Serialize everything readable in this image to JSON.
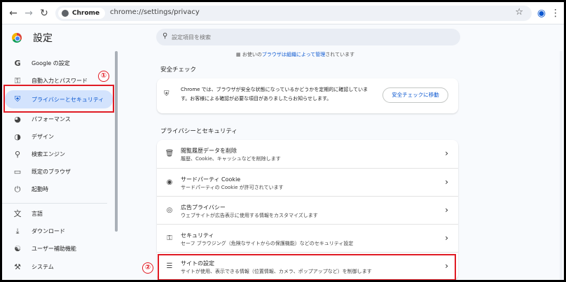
{
  "toolbar": {
    "chip_label": "Chrome",
    "url": "chrome://settings/privacy",
    "back_icon": "back-arrow-icon",
    "forward_icon": "forward-arrow-icon",
    "reload_icon": "reload-icon"
  },
  "header": {
    "title": "設定",
    "search_placeholder": "設定項目を検索"
  },
  "sidebar": {
    "items": [
      {
        "label": "Google の設定",
        "icon": "google-icon"
      },
      {
        "label": "自動入力とパスワード",
        "icon": "key-icon"
      },
      {
        "label": "プライバシーとセキュリティ",
        "icon": "shield-icon"
      },
      {
        "label": "パフォーマンス",
        "icon": "speedometer-icon"
      },
      {
        "label": "デザイン",
        "icon": "palette-icon"
      },
      {
        "label": "検索エンジン",
        "icon": "search-icon"
      },
      {
        "label": "既定のブラウザ",
        "icon": "browser-icon"
      },
      {
        "label": "起動時",
        "icon": "power-icon"
      },
      {
        "label": "言語",
        "icon": "translate-icon"
      },
      {
        "label": "ダウンロード",
        "icon": "download-icon"
      },
      {
        "label": "ユーザー補助機能",
        "icon": "accessibility-icon"
      },
      {
        "label": "システム",
        "icon": "wrench-icon"
      }
    ]
  },
  "annotations": {
    "one": "①",
    "two": "②"
  },
  "main": {
    "note_prefix": "お使いの",
    "note_link": "ブラウザは組織によって管理",
    "note_suffix": "されています",
    "safety_title": "安全チェック",
    "safety_text": "Chrome では、ブラウザが安全な状態になっているかどうかを定期的に確認しています。お客様による確認が必要な項目がありましたらお知らせします。",
    "safety_button": "安全チェックに移動",
    "privacy_title": "プライバシーとセキュリティ",
    "rows": [
      {
        "title": "閲覧履歴データを削除",
        "desc": "履歴、Cookie、キャッシュなどを削除します",
        "icon": "trash-icon"
      },
      {
        "title": "サードパーティ Cookie",
        "desc": "サードパーティの Cookie が許可されています",
        "icon": "cookie-icon"
      },
      {
        "title": "広告プライバシー",
        "desc": "ウェブサイトが広告表示に使用する情報をカスタマイズします",
        "icon": "ads-privacy-icon"
      },
      {
        "title": "セキュリティ",
        "desc": "セーフ ブラウジング（危険なサイトからの保護機能）などのセキュリティ設定",
        "icon": "lock-icon"
      },
      {
        "title": "サイトの設定",
        "desc": "サイトが使用、表示できる情報（位置情報、カメラ、ポップアップなど）を制御します",
        "icon": "sliders-icon"
      }
    ]
  }
}
